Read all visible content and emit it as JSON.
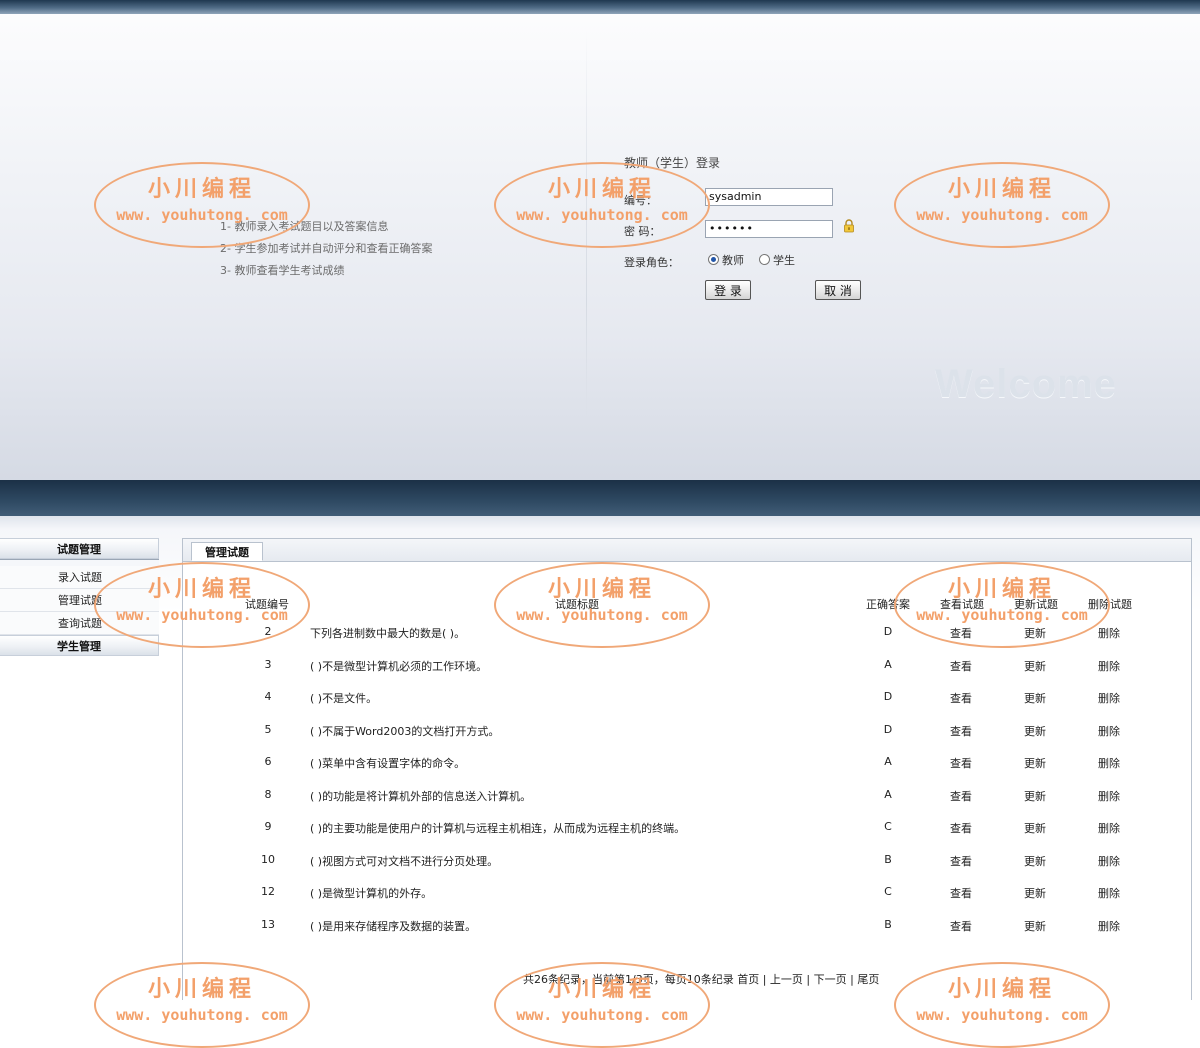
{
  "login": {
    "intro": [
      "1- 教师录入考试题目以及答案信息",
      "2- 学生参加考试并自动评分和查看正确答案",
      "3- 教师查看学生考试成绩"
    ],
    "title": "教师（学生）登录",
    "id_label": "编号：",
    "id_value": "sysadmin",
    "password_label": "密 码：",
    "password_value": "••••••",
    "role_label": "登录角色：",
    "role_teacher": "教师",
    "role_student": "学生",
    "selected_role": "教师",
    "login_button": "登 录",
    "cancel_button": "取 消",
    "welcome": "Welcome"
  },
  "admin": {
    "sidebar": {
      "group1": "试题管理",
      "items": [
        "录入试题",
        "管理试题",
        "查询试题"
      ],
      "group2": "学生管理"
    },
    "tab": "管理试题",
    "columns": {
      "id": "试题编号",
      "title": "试题标题",
      "answer": "正确答案",
      "view": "查看试题",
      "update": "更新试题",
      "delete": "删除试题"
    },
    "rows": [
      {
        "id": "2",
        "title": "下列各进制数中最大的数是( )。",
        "answer": "D"
      },
      {
        "id": "3",
        "title": "( )不是微型计算机必须的工作环境。",
        "answer": "A"
      },
      {
        "id": "4",
        "title": "( )不是文件。",
        "answer": "D"
      },
      {
        "id": "5",
        "title": "( )不属于Word2003的文档打开方式。",
        "answer": "D"
      },
      {
        "id": "6",
        "title": "( )菜单中含有设置字体的命令。",
        "answer": "A"
      },
      {
        "id": "8",
        "title": "( )的功能是将计算机外部的信息送入计算机。",
        "answer": "A"
      },
      {
        "id": "9",
        "title": "( )的主要功能是使用户的计算机与远程主机相连，从而成为远程主机的终端。",
        "answer": "C"
      },
      {
        "id": "10",
        "title": "( )视图方式可对文档不进行分页处理。",
        "answer": "B"
      },
      {
        "id": "12",
        "title": "( )是微型计算机的外存。",
        "answer": "C"
      },
      {
        "id": "13",
        "title": "( )是用来存储程序及数据的装置。",
        "answer": "B"
      }
    ],
    "actions": {
      "view": "查看",
      "update": "更新",
      "delete": "删除"
    },
    "pager": {
      "summary": "共26条纪录，当前第1/3页，每页10条纪录",
      "first": "首页",
      "prev": "上一页",
      "next": "下一页",
      "last": "尾页",
      "sep": "|"
    }
  },
  "watermark": {
    "line1": "小川编程",
    "line2": "www. youhutong. com",
    "color": "#f3a06a"
  }
}
